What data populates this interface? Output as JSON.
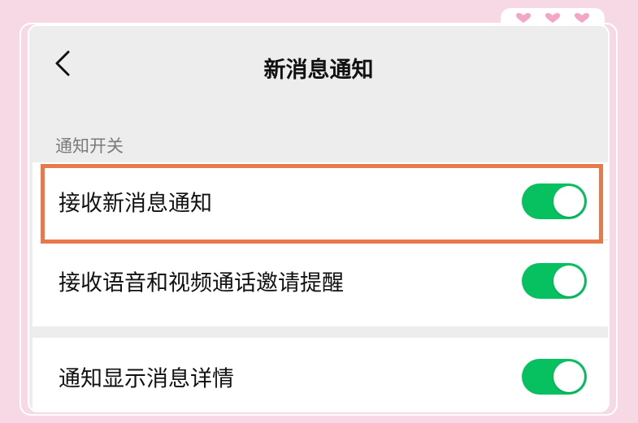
{
  "nav": {
    "title": "新消息通知",
    "back_icon": "chevron-left-icon"
  },
  "section": {
    "header": "通知开关"
  },
  "settings": [
    {
      "label": "接收新消息通知",
      "enabled": true,
      "highlighted": true
    },
    {
      "label": "接收语音和视频通话邀请提醒",
      "enabled": true,
      "highlighted": false
    },
    {
      "label": "通知显示消息详情",
      "enabled": true,
      "highlighted": false
    }
  ],
  "colors": {
    "toggle_on": "#07c160",
    "highlight": "#e8794a",
    "page_background": "#f7d9e6",
    "screen_background": "#ededed"
  }
}
